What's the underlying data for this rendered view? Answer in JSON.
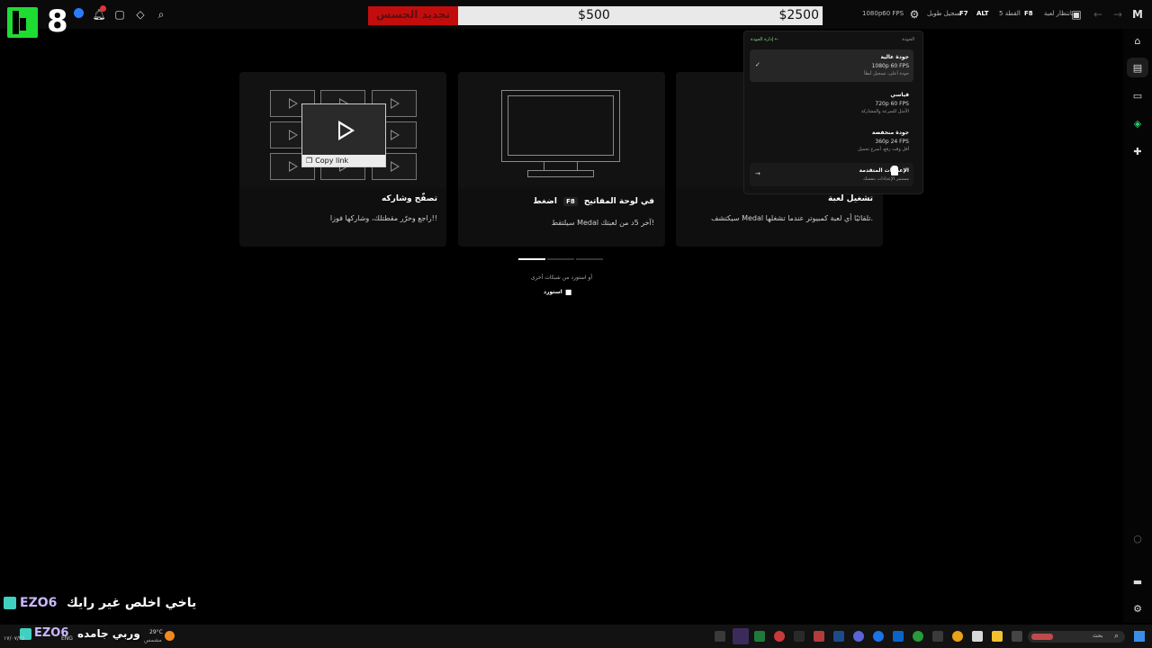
{
  "overlay": {
    "donation_red_label": "تجديد الجسس",
    "donation_current": "$500",
    "donation_goal": "$2500",
    "stream_line1": "ياخي اخلص غير رايك",
    "stream_line2": "وربي جامده",
    "tag": "EZO6"
  },
  "toolbar": {
    "quality": "1080p60 FPS",
    "key_capture": "تسجيل طويل",
    "key_f7": "F7",
    "key_alt": "ALT",
    "clip_label": "القطة 5",
    "key_f8": "F8",
    "game_label": "بانتظار لعبة"
  },
  "cards": [
    {
      "title": "تصفّح وشاركه",
      "desc": "راجع وحرّر مقطتلك، وشاركها فوزا!!"
    },
    {
      "title_prefix": "اضغط",
      "title_key": "F8",
      "title_suffix": "في لوحة المفاتيح",
      "desc": "سيلتقط Medal آخر 5د من لعبتك!"
    },
    {
      "title": "تشغيل لعبة",
      "desc": "سيكتشف Medal تلقائيًا أي لعبة كمبيوتر عندما تشغلها."
    }
  ],
  "thumbnail": {
    "copy_link": "Copy link"
  },
  "below_cards": {
    "line": "أو استورد من شبكات أخرى",
    "import_label": "استورد"
  },
  "dropdown": {
    "header": "الجودة",
    "manage_link": "إدارة الجودة ←",
    "options": [
      {
        "title": "جودة عالية",
        "res": "1080p 60 FPS",
        "sub": "جودة أعلى، تسجيل أبطأ",
        "selected": true
      },
      {
        "title": "قياسي",
        "res": "720p 60 FPS",
        "sub": "الأمثل للسرعة والمشاركة",
        "selected": false
      },
      {
        "title": "جودة منخفضة",
        "res": "360p 24 FPS",
        "sub": "أقل وقت رفع، أسرع تحميل",
        "selected": false
      },
      {
        "title": "الإعدادات المتقدمة",
        "res": "",
        "sub": "مستمر الإعدادات بنفسك",
        "selected": false
      }
    ],
    "check": "✓",
    "arrow": "→"
  },
  "taskbar": {
    "weather_temp": "29°C",
    "weather_desc": "مشمس",
    "lang": "ENG",
    "date": "١٧/٠٧/٢٥",
    "search": "بحث"
  },
  "colors": {
    "accent_green": "#1fdc33",
    "donation_red": "#c30d0d",
    "medal_highlight": "#2ecc71"
  }
}
